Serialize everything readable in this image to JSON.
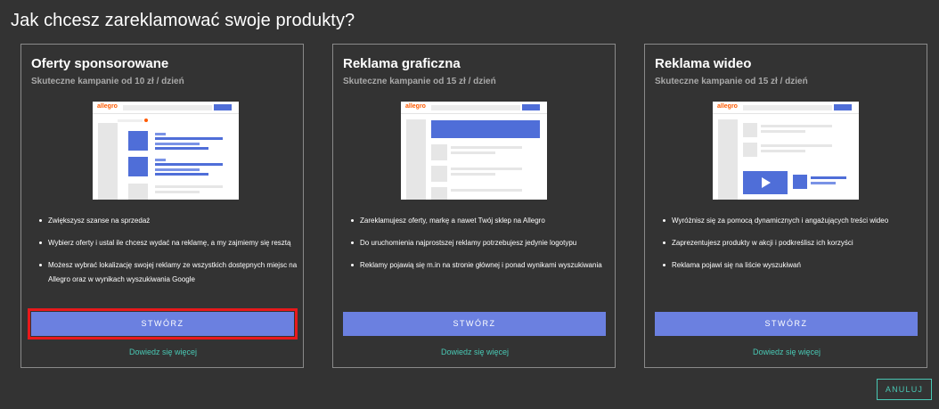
{
  "page": {
    "title": "Jak chcesz zareklamować swoje produkty?"
  },
  "cards": [
    {
      "title": "Oferty sponsorowane",
      "subtitle": "Skuteczne kampanie od 10 zł / dzień",
      "bullets": [
        "Zwiększysz szanse na sprzedaż",
        "Wybierz oferty i ustal ile chcesz wydać na reklamę, a my zajmiemy się resztą",
        "Możesz wybrać lokalizację swojej reklamy ze wszystkich dostępnych miejsc na Allegro oraz w wynikach wyszukiwania Google"
      ],
      "button_label": "STWÓRZ",
      "link_label": "Dowiedz się więcej",
      "preview_logo": "allegro"
    },
    {
      "title": "Reklama graficzna",
      "subtitle": "Skuteczne kampanie od 15 zł / dzień",
      "bullets": [
        "Zareklamujesz oferty, markę a nawet Twój sklep na Allegro",
        "Do uruchomienia najprostszej reklamy potrzebujesz jedynie logotypu",
        "Reklamy pojawią się m.in na stronie głównej i ponad wynikami wyszukiwania"
      ],
      "button_label": "STWÓRZ",
      "link_label": "Dowiedz się więcej",
      "preview_logo": "allegro"
    },
    {
      "title": "Reklama wideo",
      "subtitle": "Skuteczne kampanie od 15 zł / dzień",
      "bullets": [
        "Wyróżnisz się za pomocą dynamicznych i angażujących treści wideo",
        "Zaprezentujesz produkty w akcji i podkreślisz ich korzyści",
        "Reklama pojawi się na liście wyszukiwań"
      ],
      "button_label": "STWÓRZ",
      "link_label": "Dowiedz się więcej",
      "preview_logo": "allegro"
    }
  ],
  "footer": {
    "cancel_label": "ANULUJ"
  },
  "colors": {
    "background": "#333333",
    "button": "#6b80e0",
    "link": "#49c8b4",
    "highlight": "#e8191b",
    "brand": "#ff5a00"
  }
}
